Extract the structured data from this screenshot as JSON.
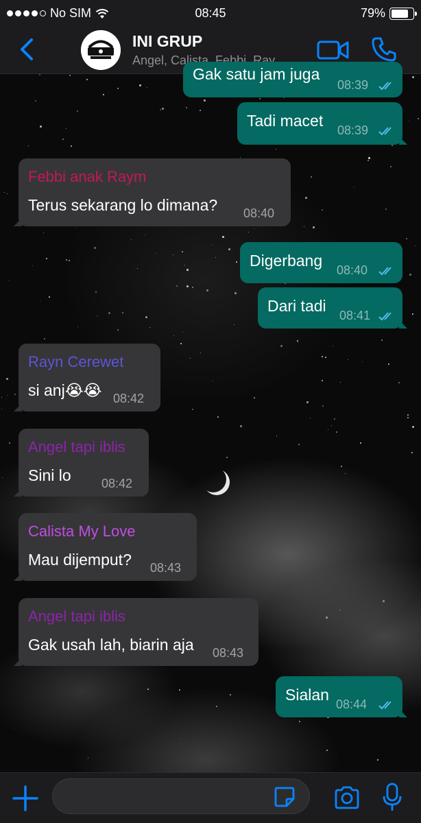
{
  "status_bar": {
    "carrier": "No SIM",
    "time": "08:45",
    "battery": "79%",
    "battery_level": 0.79
  },
  "header": {
    "title": "INI GRUP",
    "subtitle": "Angel, Calista, Febbi, Ray..."
  },
  "colors": {
    "accent": "#0a84ff",
    "outgoing_bubble": "#046a62",
    "incoming_bubble": "#363638",
    "tick_read": "#53bdeb"
  },
  "messages": [
    {
      "direction": "out",
      "text": "Gak satu jam juga",
      "time": "08:39",
      "read": true
    },
    {
      "direction": "out",
      "text": "Tadi macet",
      "time": "08:39",
      "read": true
    },
    {
      "direction": "in",
      "sender": "Febbi anak Raym",
      "sender_color": "#c2185b",
      "text": "Terus sekarang lo dimana?",
      "time": "08:40"
    },
    {
      "direction": "out",
      "text": "Digerbang",
      "time": "08:40",
      "read": true
    },
    {
      "direction": "out",
      "text": "Dari tadi",
      "time": "08:41",
      "read": true
    },
    {
      "direction": "in",
      "sender": "Rayn Cerewet",
      "sender_color": "#5c55d6",
      "text": "si anj😭😭",
      "time": "08:42"
    },
    {
      "direction": "in",
      "sender": "Angel tapi iblis",
      "sender_color": "#8e24aa",
      "text": "Sini lo",
      "time": "08:42"
    },
    {
      "direction": "in",
      "sender": "Calista My Love",
      "sender_color": "#c04ee0",
      "text": "Mau dijemput?",
      "time": "08:43"
    },
    {
      "direction": "in",
      "sender": "Angel tapi iblis",
      "sender_color": "#8e24aa",
      "text": "Gak usah lah, biarin aja",
      "time": "08:43"
    },
    {
      "direction": "out",
      "text": "Sialan",
      "time": "08:44",
      "read": true
    }
  ],
  "composer": {
    "value": "",
    "placeholder": ""
  }
}
